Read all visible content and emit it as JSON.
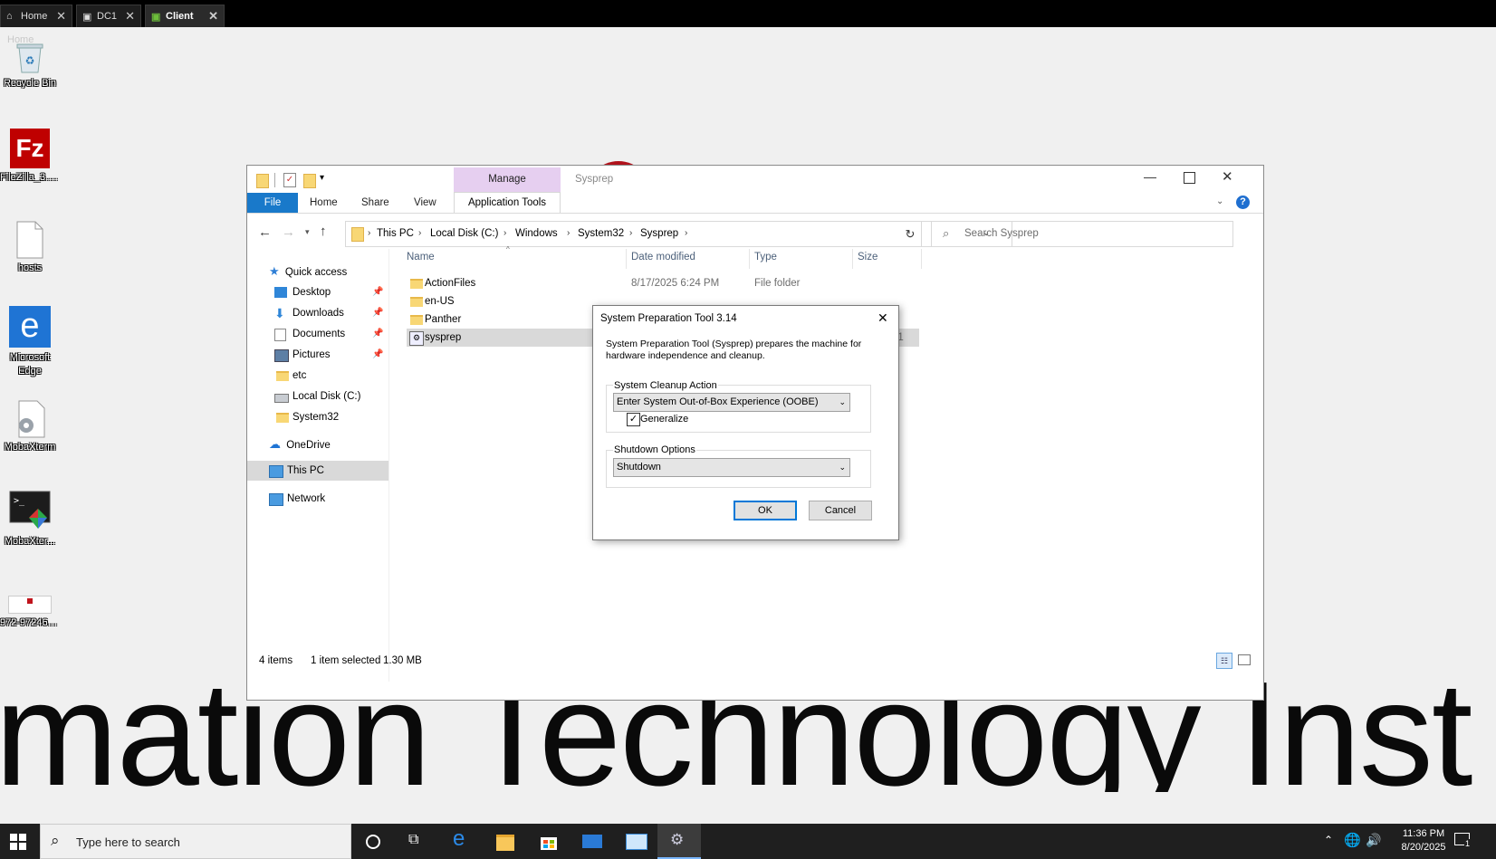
{
  "remote_tabs": [
    {
      "label": "Home",
      "close": "✕"
    },
    {
      "label": "DC1",
      "close": "✕"
    },
    {
      "label": "Client",
      "close": "✕"
    }
  ],
  "desktop": {
    "home_text": "Home",
    "icons": [
      {
        "label": "Recycle Bin"
      },
      {
        "label": "FileZilla_3.5..."
      },
      {
        "label": "hosts"
      },
      {
        "label": "Microsoft Edge"
      },
      {
        "label": "MobaXterm"
      },
      {
        "label": "MobaXter..."
      },
      {
        "label": "972-972467..."
      }
    ],
    "watermark": "mation Technology Inst"
  },
  "explorer": {
    "title": "Sysprep",
    "manage_tab": "Manage",
    "ribbon_tabs": [
      "File",
      "Home",
      "Share",
      "View",
      "Application Tools"
    ],
    "breadcrumb": [
      "This PC",
      "Local Disk (C:)",
      "Windows",
      "System32",
      "Sysprep"
    ],
    "search_placeholder": "Search Sysprep",
    "nav": {
      "quick_access": "Quick access",
      "items": [
        "Desktop",
        "Downloads",
        "Documents",
        "Pictures",
        "etc",
        "Local Disk (C:)",
        "System32"
      ],
      "onedrive": "OneDrive",
      "this_pc": "This PC",
      "network": "Network"
    },
    "columns": {
      "name": "Name",
      "date": "Date modified",
      "type": "Type",
      "size": "Size"
    },
    "files": [
      {
        "name": "ActionFiles",
        "date": "8/17/2025 6:24 PM",
        "type": "File folder",
        "size": ""
      },
      {
        "name": "en-US",
        "date": "",
        "type": "",
        "size": ""
      },
      {
        "name": "Panther",
        "date": "",
        "type": "",
        "size": ""
      },
      {
        "name": "sysprep",
        "date": "",
        "type": "",
        "size": "1,341 KB"
      }
    ],
    "status": {
      "items": "4 items",
      "selected": "1 item selected",
      "size": "1.30 MB"
    }
  },
  "dialog": {
    "title": "System Preparation Tool 3.14",
    "description": "System Preparation Tool (Sysprep) prepares the machine for hardware independence and cleanup.",
    "cleanup_label": "System Cleanup Action",
    "cleanup_value": "Enter System Out-of-Box Experience (OOBE)",
    "generalize_label": "Generalize",
    "generalize_checked": true,
    "shutdown_label": "Shutdown Options",
    "shutdown_value": "Shutdown",
    "ok": "OK",
    "cancel": "Cancel"
  },
  "taskbar": {
    "search_placeholder": "Type here to search",
    "time": "11:36 PM",
    "date": "8/20/2025",
    "notification_count": "1"
  }
}
